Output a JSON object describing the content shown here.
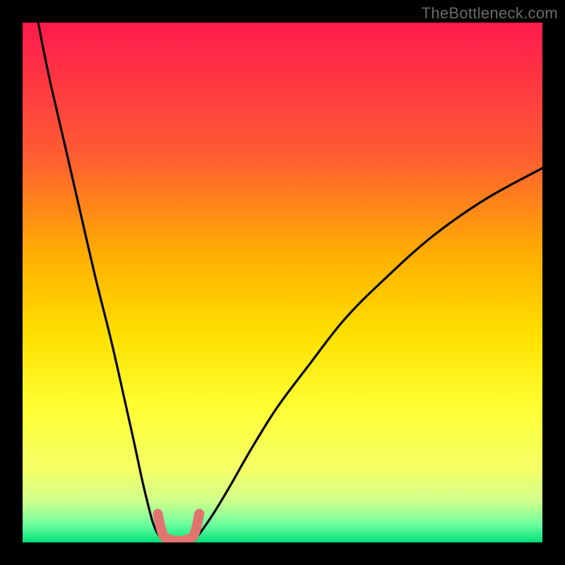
{
  "watermark": "TheBottleneck.com",
  "chart_data": {
    "type": "line",
    "title": "",
    "xlabel": "",
    "ylabel": "",
    "xlim": [
      0,
      100
    ],
    "ylim": [
      0,
      100
    ],
    "grid": false,
    "legend": false,
    "background_gradient": {
      "stops": [
        {
          "offset": 0.0,
          "color": "#ff1a4d"
        },
        {
          "offset": 0.25,
          "color": "#ff5a33"
        },
        {
          "offset": 0.45,
          "color": "#ffb000"
        },
        {
          "offset": 0.6,
          "color": "#ffe000"
        },
        {
          "offset": 0.74,
          "color": "#ffff33"
        },
        {
          "offset": 0.86,
          "color": "#f4ff66"
        },
        {
          "offset": 0.92,
          "color": "#d0ff8c"
        },
        {
          "offset": 0.965,
          "color": "#6eff9e"
        },
        {
          "offset": 1.0,
          "color": "#00e07a"
        }
      ]
    },
    "series": [
      {
        "name": "left-branch",
        "x": [
          3.0,
          5.0,
          8.0,
          11.0,
          14.0,
          17.0,
          19.5,
          21.5,
          23.0,
          24.2,
          25.0,
          25.8,
          26.5
        ],
        "y": [
          100.0,
          90.0,
          77.0,
          64.0,
          51.0,
          39.0,
          28.0,
          19.0,
          12.0,
          7.0,
          4.0,
          2.0,
          1.0
        ]
      },
      {
        "name": "right-branch",
        "x": [
          33.5,
          35.0,
          37.0,
          40.0,
          44.0,
          49.0,
          55.0,
          62.0,
          70.0,
          79.0,
          89.0,
          100.0
        ],
        "y": [
          1.0,
          3.0,
          6.0,
          11.0,
          18.0,
          26.0,
          34.0,
          43.0,
          51.0,
          59.0,
          66.0,
          72.0
        ]
      },
      {
        "name": "trough-marker",
        "x": [
          26.0,
          27.0,
          28.5,
          30.0,
          31.5,
          33.0,
          34.0
        ],
        "y": [
          5.5,
          1.5,
          0.5,
          0.3,
          0.5,
          1.5,
          5.5
        ]
      }
    ]
  }
}
